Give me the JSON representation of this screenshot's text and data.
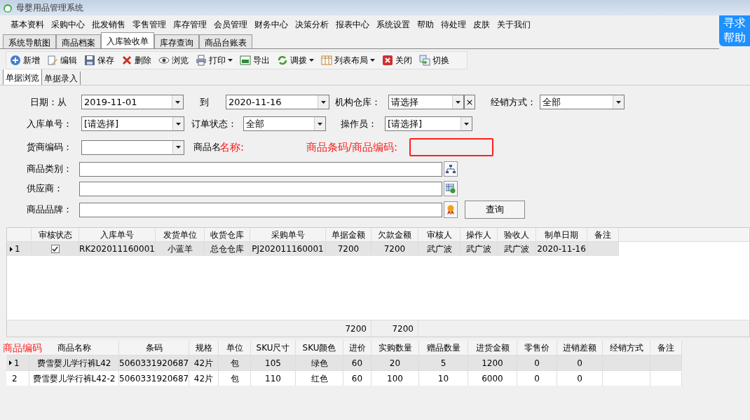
{
  "window": {
    "title": "母婴用品管理系统"
  },
  "menu": [
    "基本资料",
    "采购中心",
    "批发销售",
    "零售管理",
    "库存管理",
    "会员管理",
    "财务中心",
    "决策分析",
    "报表中心",
    "系统设置",
    "帮助",
    "待处理",
    "皮肤",
    "关于我们"
  ],
  "help_button": "寻求帮助",
  "tabs": [
    {
      "label": "系统导航图",
      "selected": false
    },
    {
      "label": "商品档案",
      "selected": false
    },
    {
      "label": "入库验收单",
      "selected": true
    },
    {
      "label": "库存查询",
      "selected": false
    },
    {
      "label": "商品台账表",
      "selected": false
    }
  ],
  "toolbar": [
    {
      "kind": "add",
      "label": "新增",
      "dropdown": false
    },
    {
      "kind": "edit",
      "label": "编辑",
      "dropdown": false
    },
    {
      "kind": "save",
      "label": "保存",
      "dropdown": false
    },
    {
      "kind": "delete",
      "label": "删除",
      "dropdown": false
    },
    {
      "kind": "view",
      "label": "浏览",
      "dropdown": false
    },
    {
      "kind": "print",
      "label": "打印",
      "dropdown": true
    },
    {
      "kind": "export",
      "label": "导出",
      "dropdown": false
    },
    {
      "kind": "transfer",
      "label": "调拨",
      "dropdown": true
    },
    {
      "kind": "layout",
      "label": "列表布局",
      "dropdown": true
    },
    {
      "kind": "close",
      "label": "关闭",
      "dropdown": false
    },
    {
      "kind": "switch",
      "label": "切换",
      "dropdown": false
    }
  ],
  "subtabs": [
    {
      "label": "单据浏览",
      "selected": true
    },
    {
      "label": "单据录入",
      "selected": false
    }
  ],
  "filters": {
    "date_from": {
      "label": "日期：从",
      "value": "2019-11-01"
    },
    "date_to": {
      "label": "到",
      "value": "2020-11-16"
    },
    "warehouse": {
      "label": "机构仓库：",
      "value": "请选择",
      "clear": "×"
    },
    "sales_mode": {
      "label": "经销方式：",
      "value": "全部"
    },
    "receipt_no": {
      "label": "入库单号：",
      "value": "[请选择]"
    },
    "order_status": {
      "label": "订单状态：",
      "value": "全部"
    },
    "operator": {
      "label": "操作员：",
      "value": "[请选择]"
    },
    "vendor_code": {
      "label": "货商编码："
    },
    "product_name": {
      "label": "商品名",
      "annotation": "名称:"
    },
    "barcode": {
      "annotation": "商品条码/商品编码:"
    },
    "category": {
      "label": "商品类别："
    },
    "supplier": {
      "label": "供应商："
    },
    "brand": {
      "label": "商品品牌："
    },
    "query_button": "查询"
  },
  "receipts": {
    "columns": [
      "审核状态",
      "入库单号",
      "发货单位",
      "收货仓库",
      "采购单号",
      "单据金额",
      "欠款金额",
      "审核人",
      "操作人",
      "验收人",
      "制单日期",
      "备注"
    ],
    "rows": [
      {
        "index": "1",
        "selected": true,
        "cells": [
          {
            "checked": true
          },
          "RK202011160001",
          "小蓝羊",
          "总仓仓库",
          "PJ202011160001",
          "7200",
          "7200",
          "武广波",
          "武广波",
          "武广波",
          "2020-11-16",
          ""
        ]
      }
    ],
    "totals": [
      "7200",
      "7200"
    ]
  },
  "items": {
    "annotation": "商品编码",
    "columns": [
      "商品名称",
      "条码",
      "规格",
      "单位",
      "SKU尺寸",
      "SKU颜色",
      "进价",
      "实购数量",
      "赠品数量",
      "进货金额",
      "零售价",
      "进销差额",
      "经销方式",
      "备注"
    ],
    "rows": [
      {
        "index": "1",
        "selected": true,
        "cells": [
          "费雪婴儿学行裤L42",
          "5060331920687",
          "42片",
          "包",
          "105",
          "绿色",
          "60",
          "20",
          "5",
          "1200",
          "0",
          "0",
          "",
          ""
        ]
      },
      {
        "index": "2",
        "selected": false,
        "cells": [
          "费雪婴儿学行裤L42-2",
          "5060331920687",
          "42片",
          "包",
          "110",
          "红色",
          "60",
          "100",
          "10",
          "6000",
          "0",
          "0",
          "",
          ""
        ]
      }
    ]
  }
}
